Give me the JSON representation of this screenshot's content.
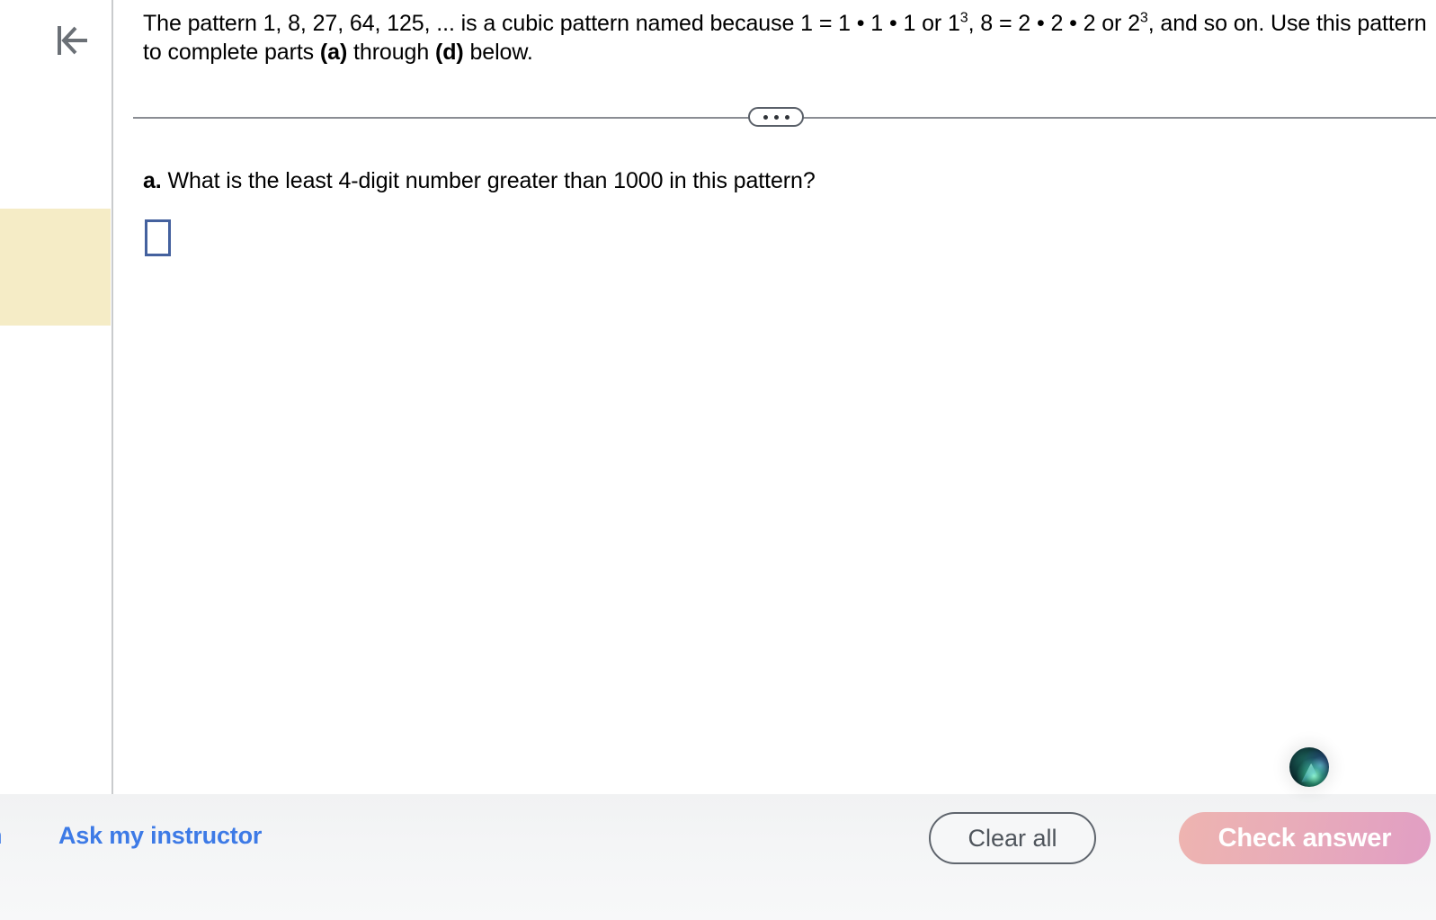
{
  "left_rail": {
    "back_icon": "skip-to-start-icon",
    "highlight_color": "#f5ecc6"
  },
  "problem": {
    "intro_part1": "The pattern 1, 8, 27, 64, 125, ... is a cubic pattern named because 1 = 1",
    "dot": "•",
    "text_full_line1": "The pattern 1, 8, 27, 64, 125, ... is a cubic pattern named because 1 = 1 • 1 • 1 or 1",
    "exp1": "3",
    "text_mid": ", 8 = 2 • 2 • 2 or 2",
    "exp2": "3",
    "text_end": ", and so on. Use this pattern to complete parts",
    "bold_a": "(a)",
    "through": "through",
    "bold_d": "(d)",
    "below": "below.",
    "divider_dots": "•••"
  },
  "part_a": {
    "label": "a.",
    "question": "What is the least 4-digit number greater than 1000 in this pattern?",
    "answer_value": "",
    "answer_placeholder": ""
  },
  "toolbar": {
    "cut_label": "n",
    "ask_instructor_label": "Ask my instructor",
    "clear_all_label": "Clear all",
    "check_answer_label": "Check answer",
    "link_color": "#3d7ae6",
    "check_color": "#e19ec4"
  },
  "assistant": {
    "orb_label": "assistant-orb"
  }
}
